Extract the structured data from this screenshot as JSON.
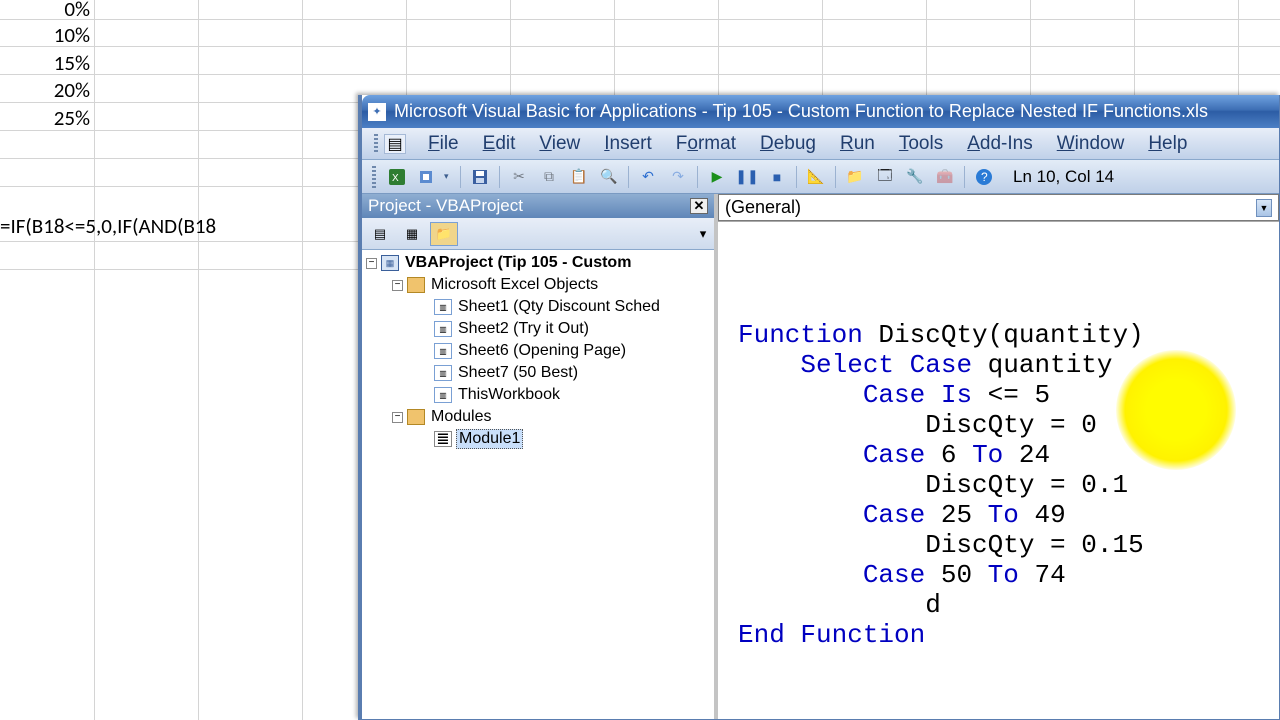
{
  "excel": {
    "cells": [
      "0%",
      "10%",
      "15%",
      "20%",
      "25%"
    ],
    "formula": "=IF(B18<=5,0,IF(AND(B18"
  },
  "vba": {
    "title": "Microsoft Visual Basic for Applications - Tip 105 - Custom Function to Replace Nested IF Functions.xls",
    "menus": [
      "File",
      "Edit",
      "View",
      "Insert",
      "Format",
      "Debug",
      "Run",
      "Tools",
      "Add-Ins",
      "Window",
      "Help"
    ],
    "status": "Ln 10, Col 14",
    "project_panel_title": "Project - VBAProject",
    "tree": {
      "root": "VBAProject (Tip 105 - Custom ",
      "excel_objects": "Microsoft Excel Objects",
      "sheets": [
        "Sheet1 (Qty Discount Sched",
        "Sheet2 (Try it Out)",
        "Sheet6 (Opening Page)",
        "Sheet7 (50 Best)",
        "ThisWorkbook"
      ],
      "modules_folder": "Modules",
      "module": "Module1"
    },
    "code": {
      "scope": "(General)",
      "lines": [
        {
          "t": "Function DiscQty(quantity)",
          "kw": [
            "Function"
          ]
        },
        {
          "t": "    Select Case quantity",
          "kw": [
            "Select",
            "Case"
          ]
        },
        {
          "t": "        Case Is <= 5",
          "kw": [
            "Case",
            "Is"
          ]
        },
        {
          "t": "            DiscQty = 0",
          "kw": []
        },
        {
          "t": "        Case 6 To 24",
          "kw": [
            "Case",
            "To"
          ]
        },
        {
          "t": "            DiscQty = 0.1",
          "kw": []
        },
        {
          "t": "        Case 25 To 49",
          "kw": [
            "Case",
            "To"
          ]
        },
        {
          "t": "            DiscQty = 0.15",
          "kw": []
        },
        {
          "t": "        Case 50 To 74",
          "kw": [
            "Case",
            "To"
          ]
        },
        {
          "t": "            d",
          "kw": []
        },
        {
          "t": "End Function",
          "kw": [
            "End",
            "Function"
          ]
        }
      ]
    }
  }
}
